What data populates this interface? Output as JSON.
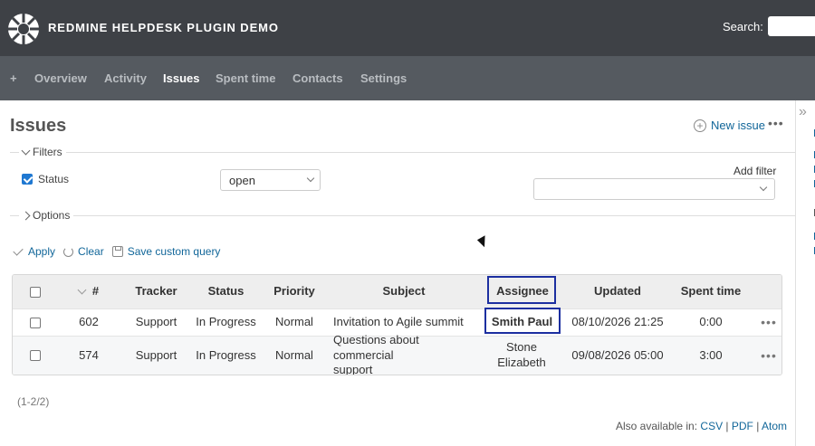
{
  "header": {
    "app_title": "REDMINE HELPDESK PLUGIN DEMO",
    "search_label": "Search:",
    "search_value": ""
  },
  "menu": {
    "items": [
      {
        "label": "+"
      },
      {
        "label": "Overview"
      },
      {
        "label": "Activity"
      },
      {
        "label": "Issues",
        "active": true
      },
      {
        "label": "Spent time"
      },
      {
        "label": "Contacts"
      },
      {
        "label": "Settings"
      }
    ]
  },
  "page": {
    "title": "Issues",
    "new_issue_label": "New issue",
    "more_label": "•••"
  },
  "filters": {
    "legend": "Filters",
    "status_label": "Status",
    "status_checked": true,
    "status_value": "open",
    "add_filter_label": "Add filter",
    "add_filter_value": ""
  },
  "options": {
    "legend": "Options"
  },
  "query_actions": {
    "apply": "Apply",
    "clear": "Clear",
    "save": "Save custom query"
  },
  "table": {
    "columns": [
      "#",
      "Tracker",
      "Status",
      "Priority",
      "Subject",
      "Assignee",
      "Updated",
      "Spent time"
    ],
    "rows": [
      {
        "id": "602",
        "tracker": "Support",
        "status": "In Progress",
        "priority": "Normal",
        "subject": "Invitation to Agile summit",
        "assignee": "Smith Paul",
        "updated": "08/10/2026 21:25",
        "spent_time": "0:00"
      },
      {
        "id": "574",
        "tracker": "Support",
        "status": "In Progress",
        "priority": "Normal",
        "subject": "Questions about commercial support",
        "assignee": "Stone Elizabeth",
        "updated": "09/08/2026 05:00",
        "spent_time": "3:00"
      }
    ],
    "row_menu_label": "•••"
  },
  "pagination": {
    "count": "(1-2/2)"
  },
  "other_formats": {
    "label": "Also available in:",
    "links": [
      "CSV",
      "PDF",
      "Atom"
    ]
  },
  "sidebar": {
    "toggle_label": "»"
  },
  "colors": {
    "header_bg": "#3e4146",
    "menu_bg": "#555a60",
    "link": "#116699",
    "highlight_border": "#1c2fa0",
    "checkbox_checked": "#1f78d1"
  }
}
